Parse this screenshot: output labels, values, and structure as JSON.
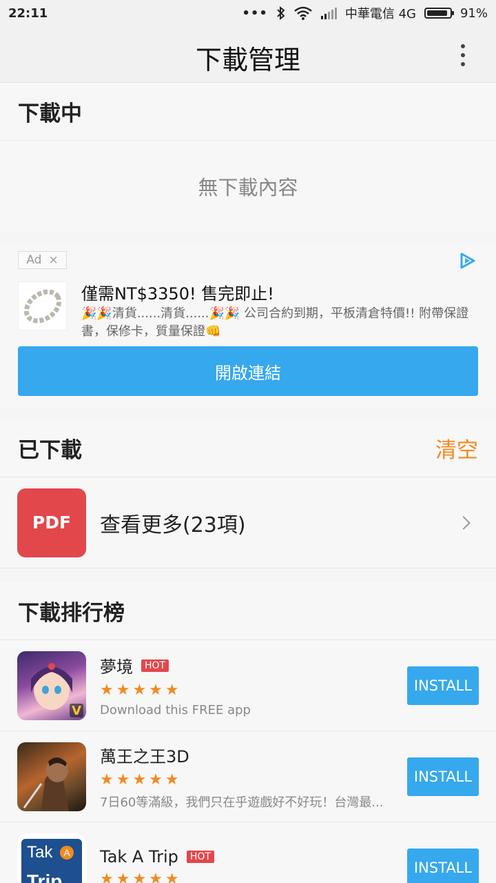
{
  "status_bar": {
    "time": "22:11",
    "dots": "•••",
    "carrier": "中華電信 4G",
    "battery": "91%",
    "battery_level": 0.91
  },
  "app_bar": {
    "title": "下載管理"
  },
  "downloading": {
    "header": "下載中",
    "empty": "無下載內容"
  },
  "ad": {
    "tag": "Ad",
    "tag_close": "×",
    "title": "僅需NT$3350! 售完即止!",
    "desc": "🎉🎉清貨......清貨......🎉🎉 公司合約到期，平板清倉特價!! 附帶保證書，保修卡，質量保證👊",
    "cta": "開啟連結"
  },
  "downloaded": {
    "header": "已下載",
    "clear": "清空",
    "pdf_icon": "PDF",
    "more": "查看更多(23項)"
  },
  "ranking": {
    "header": "下載排行榜",
    "apps": [
      {
        "name": "夢境",
        "hot": "HOT",
        "stars": "★★★★★",
        "rating": 4.5,
        "desc": "Download this FREE app",
        "install": "INSTALL"
      },
      {
        "name": "萬王之王3D",
        "hot": "",
        "stars": "★★★★★",
        "rating": 5,
        "desc": "7日60等滿級，我們只在乎遊戲好不好玩！台灣最...",
        "install": "INSTALL"
      },
      {
        "name": "Tak A Trip",
        "hot": "HOT",
        "stars": "★★★★★",
        "rating": 5,
        "desc": "",
        "install": "INSTALL"
      }
    ]
  },
  "icon_texts": {
    "tak": "Tak",
    "a": "A",
    "trip": "Trip",
    "game": "V"
  },
  "colors": {
    "accent": "#36a8ee",
    "orange": "#f28a20",
    "red": "#e2474c"
  }
}
